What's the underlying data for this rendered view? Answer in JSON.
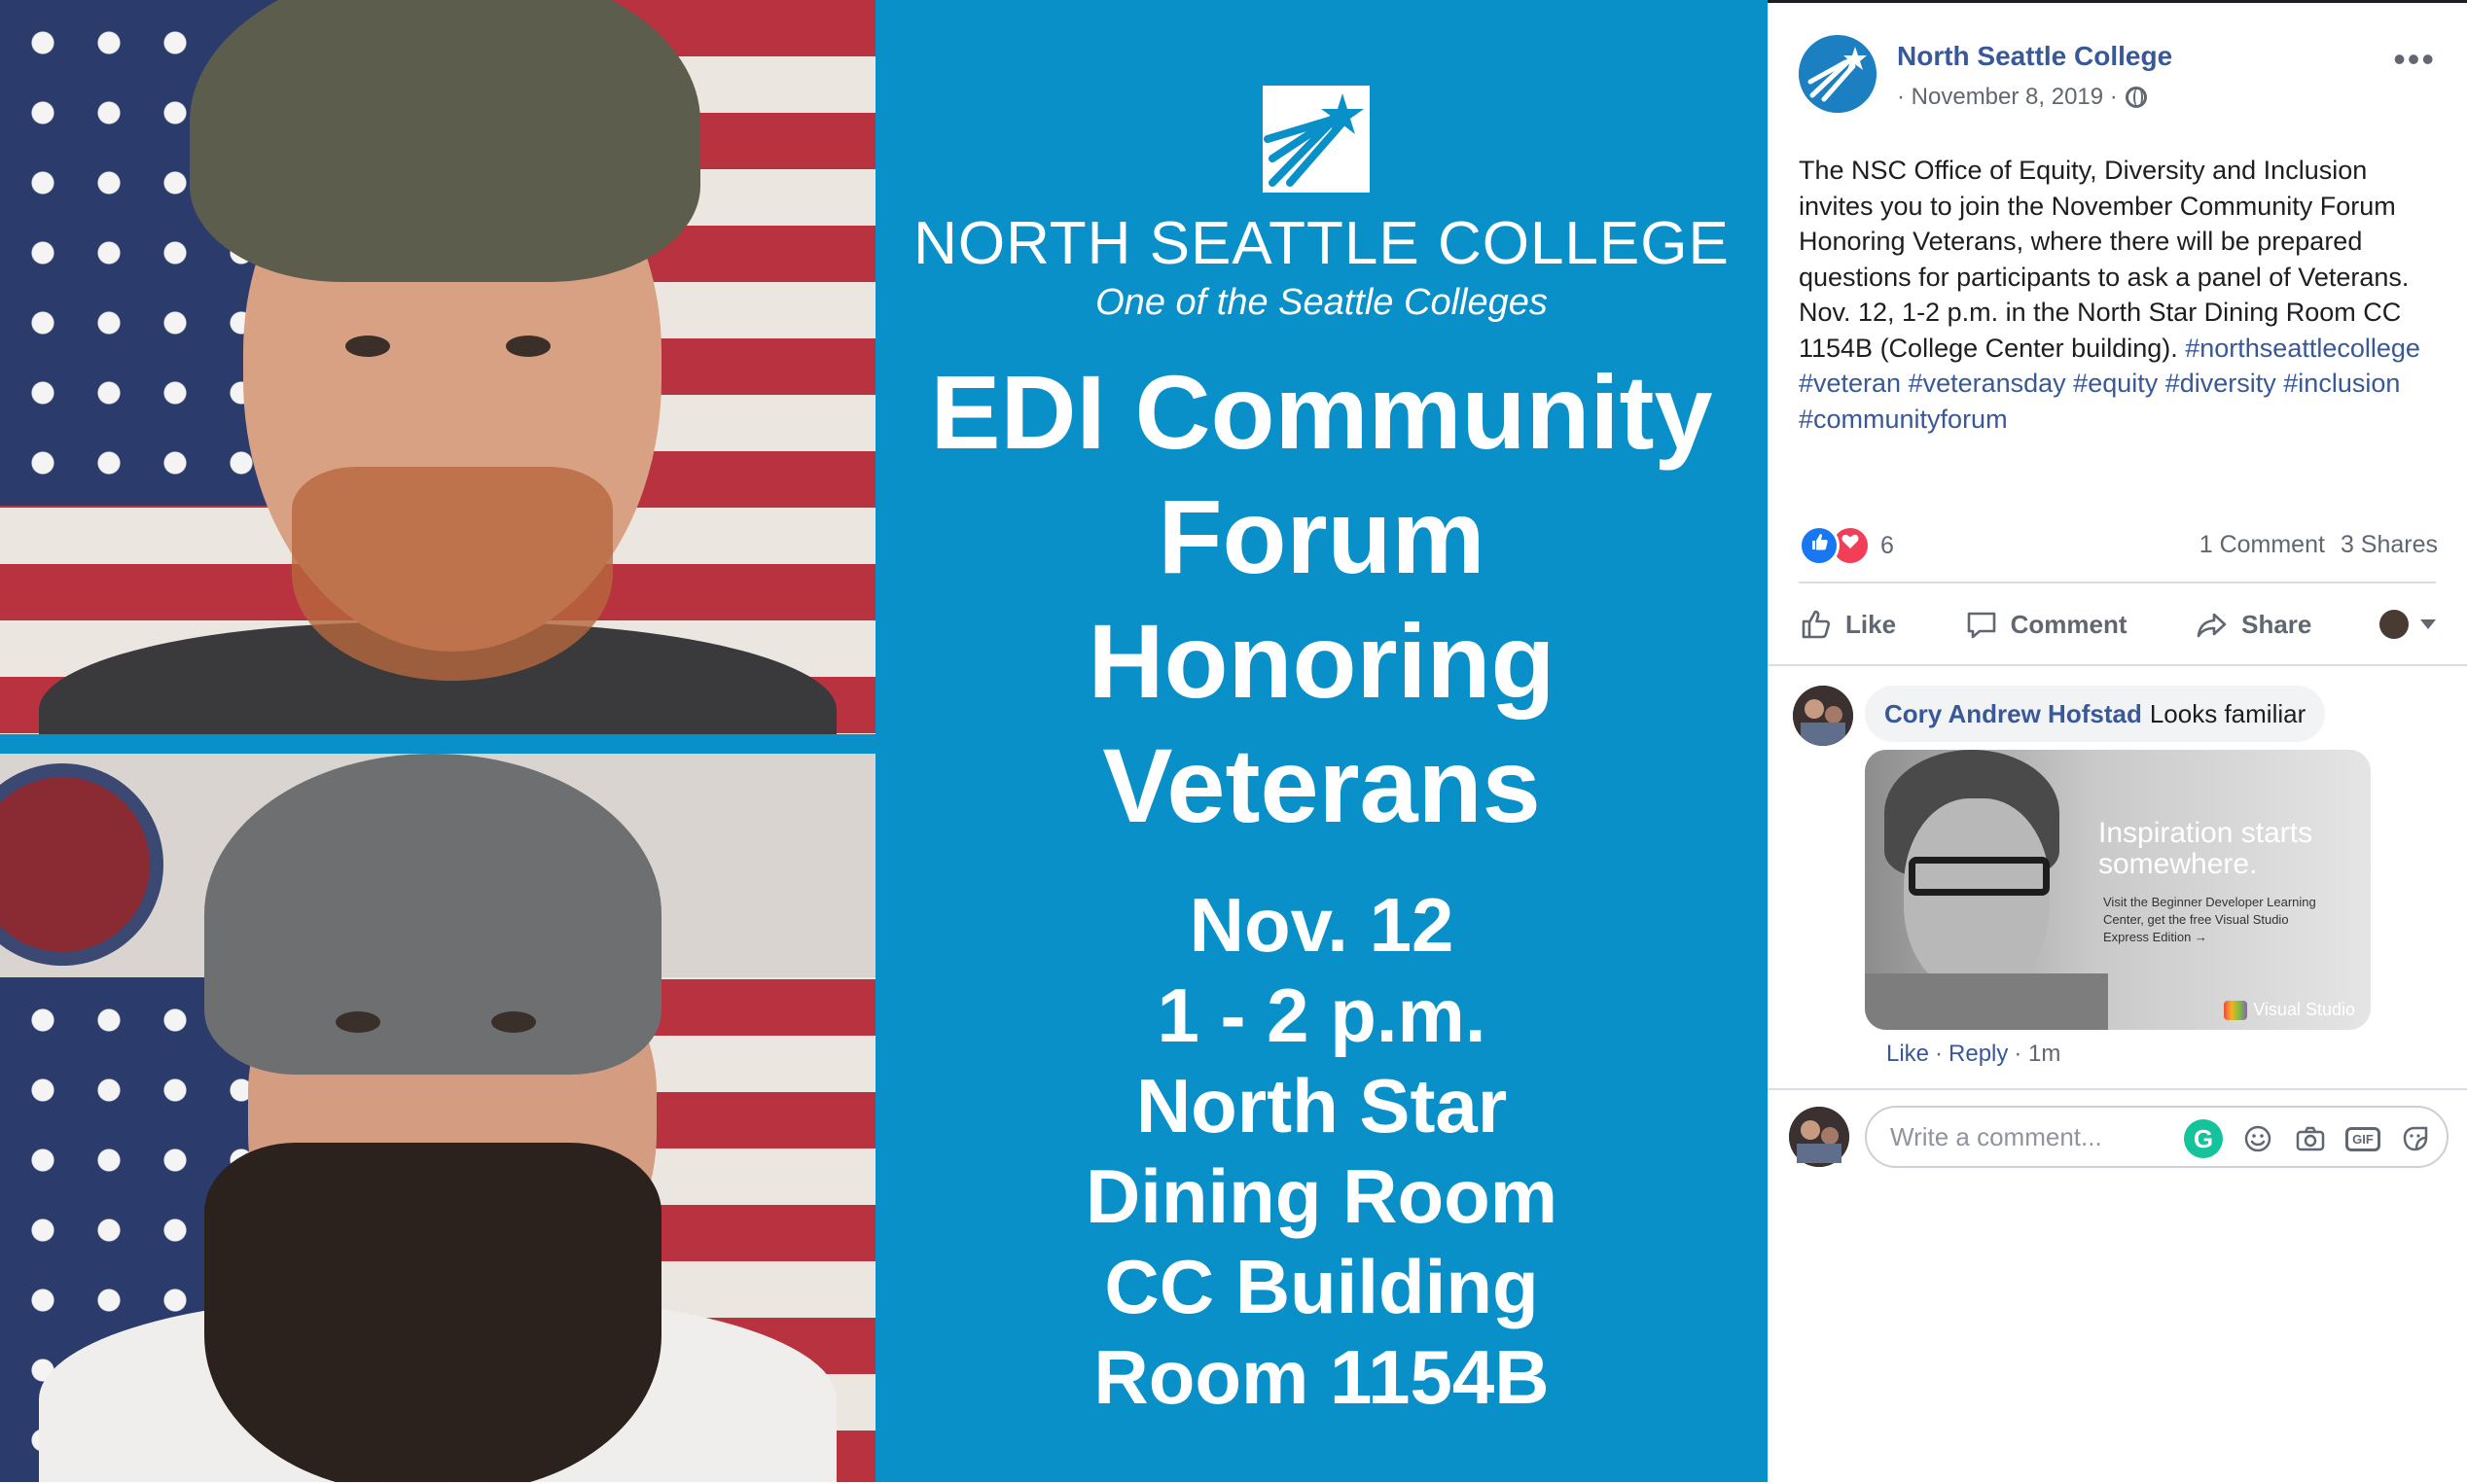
{
  "poster": {
    "college_name": "NORTH SEATTLE COLLEGE",
    "tagline": "One of the Seattle Colleges",
    "headline_lines": [
      "EDI Community",
      "Forum",
      "Honoring",
      "Veterans"
    ],
    "detail_lines": [
      "Nov. 12",
      "1 - 2 p.m.",
      "North Star",
      "Dining Room",
      "CC Building",
      "Room 1154B"
    ],
    "background_color": "#0a90c8"
  },
  "post": {
    "page_name": "North Seattle College",
    "date": "· November 8, 2019 ·",
    "body": "The NSC Office of Equity, Diversity and Inclusion invites you to join the November Community Forum Honoring Veterans, where there will be prepared questions for participants to ask a panel of Veterans. Nov. 12, 1-2 p.m. in the North Star Dining Room CC 1154B (College Center building).",
    "hashtags": "#northseattlecollege #veteran #veteransday #equity #diversity #inclusion #communityforum",
    "more_icon": "•••",
    "reaction_count": "6",
    "comments_count": "1 Comment",
    "shares_count": "3 Shares",
    "actions": {
      "like": "Like",
      "comment": "Comment",
      "share": "Share"
    },
    "accent_color": "#385898"
  },
  "comment": {
    "author": "Cory Andrew Hofstad",
    "text": "Looks familiar",
    "image": {
      "headline": "Inspiration starts somewhere.",
      "subtext": "Visit the Beginner Developer Learning Center, get the free Visual Studio Express Edition →",
      "brand": "Visual Studio"
    },
    "like_label": "Like",
    "separator": "·",
    "reply_label": "Reply",
    "time": "· 1m"
  },
  "composer": {
    "placeholder": "Write a comment...",
    "icons": [
      "grammarly-icon",
      "emoji-icon",
      "camera-icon",
      "gif-icon",
      "sticker-icon"
    ],
    "grammarly_letter": "G",
    "gif_label": "GIF"
  }
}
